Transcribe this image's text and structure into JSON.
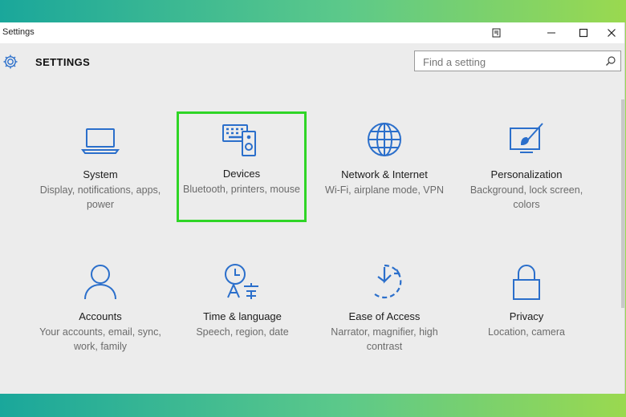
{
  "window": {
    "title": "Settings"
  },
  "header": {
    "title": "SETTINGS"
  },
  "search": {
    "placeholder": "Find a setting"
  },
  "tiles": [
    {
      "name": "System",
      "desc": "Display, notifications, apps, power",
      "icon": "laptop-icon"
    },
    {
      "name": "Devices",
      "desc": "Bluetooth, printers, mouse",
      "icon": "devices-icon",
      "selected": true
    },
    {
      "name": "Network & Internet",
      "desc": "Wi-Fi, airplane mode, VPN",
      "icon": "globe-icon"
    },
    {
      "name": "Personalization",
      "desc": "Background, lock screen, colors",
      "icon": "paint-icon"
    },
    {
      "name": "Accounts",
      "desc": "Your accounts, email, sync, work, family",
      "icon": "person-icon"
    },
    {
      "name": "Time & language",
      "desc": "Speech, region, date",
      "icon": "time-language-icon"
    },
    {
      "name": "Ease of Access",
      "desc": "Narrator, magnifier, high contrast",
      "icon": "ease-of-access-icon"
    },
    {
      "name": "Privacy",
      "desc": "Location, camera",
      "icon": "lock-icon"
    }
  ],
  "colors": {
    "accent": "#2b6fcb",
    "highlight": "#2fd526"
  }
}
